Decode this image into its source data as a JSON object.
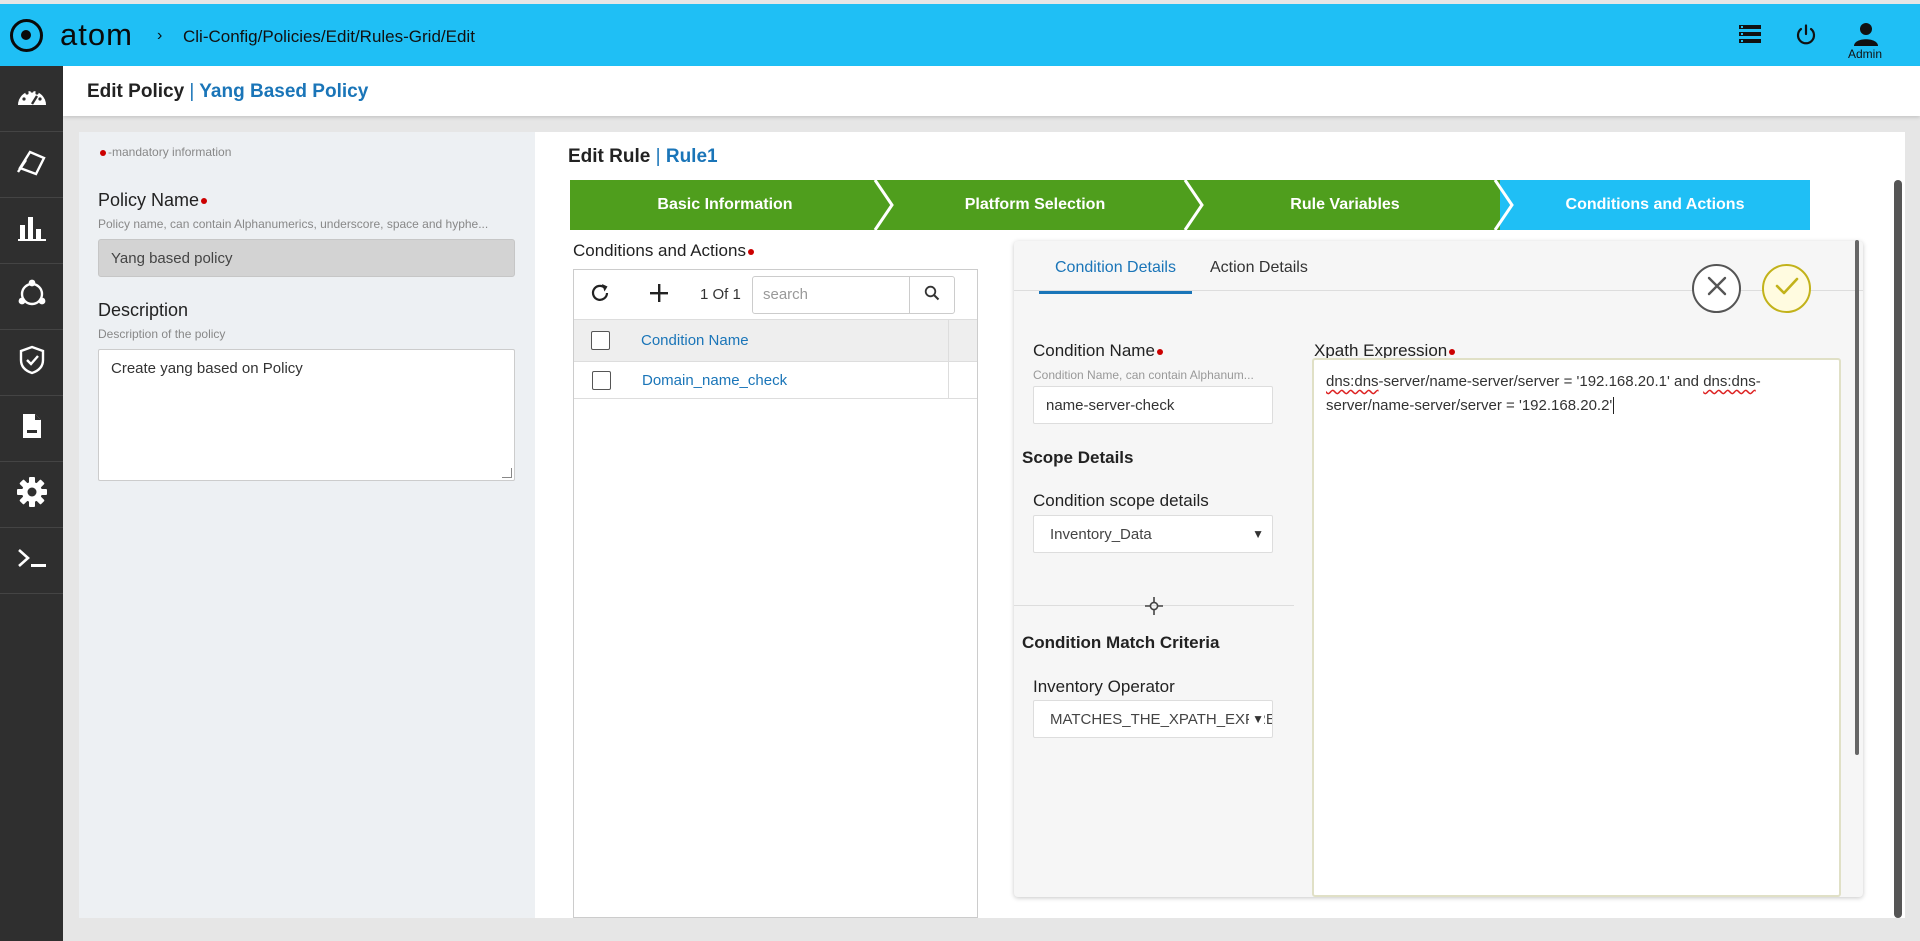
{
  "app": {
    "logo_text": "atom",
    "breadcrumb": "Cli-Config/Policies/Edit/Rules-Grid/Edit",
    "user_label": "Admin"
  },
  "icons": {
    "topbar": [
      "menu-list-icon",
      "power-icon",
      "user-icon"
    ],
    "nav": [
      "dashboard-icon",
      "devices-icon",
      "chart-icon",
      "network-icon",
      "shield-icon",
      "document-icon",
      "gear-icon",
      "terminal-icon"
    ]
  },
  "page": {
    "title": "Edit Policy",
    "separator": "|",
    "subtitle": "Yang Based Policy"
  },
  "policy_form": {
    "mandatory_note": "-mandatory information",
    "policy_name_label": "Policy Name",
    "policy_name_hint": "Policy name, can contain Alphanumerics, underscore, space and hyphe...",
    "policy_name_value": "Yang based policy",
    "description_label": "Description",
    "description_hint": "Description of the policy",
    "description_value": "Create yang based on Policy"
  },
  "rule": {
    "title": "Edit Rule",
    "separator": "|",
    "name": "Rule1"
  },
  "wizard_steps": [
    {
      "label": "Basic Information",
      "state": "done"
    },
    {
      "label": "Platform Selection",
      "state": "done"
    },
    {
      "label": "Rule Variables",
      "state": "done"
    },
    {
      "label": "Conditions and Actions",
      "state": "active"
    }
  ],
  "conditions_grid": {
    "section_label": "Conditions and Actions",
    "page_info": "1 Of 1",
    "search_placeholder": "search",
    "column_header": "Condition Name",
    "rows": [
      "Domain_name_check"
    ]
  },
  "detail_tabs": [
    {
      "label": "Condition Details",
      "active": true
    },
    {
      "label": "Action Details",
      "active": false
    }
  ],
  "condition_details": {
    "name_label": "Condition Name",
    "name_hint": "Condition Name, can contain Alphanum...",
    "name_value": "name-server-check",
    "scope_section": "Scope Details",
    "scope_label": "Condition scope details",
    "scope_value": "Inventory_Data",
    "match_section": "Condition Match Criteria",
    "operator_label": "Inventory Operator",
    "operator_value": "MATCHES_THE_XPATH_EXPRESSION",
    "xpath_label": "Xpath Expression",
    "xpath_value_part1": "dns:dns-server/name-server/server = '192.168.20.1' and dns:dns-server/name-server/server = '192.168.20.2'"
  },
  "colors": {
    "topbar": "#1fbff5",
    "nav": "#2f2f2f",
    "step_done": "#4f9e1d",
    "step_active": "#1fbff5",
    "link": "#1a75b8",
    "mandatory": "#cc0000",
    "confirm": "#c2b21a"
  }
}
